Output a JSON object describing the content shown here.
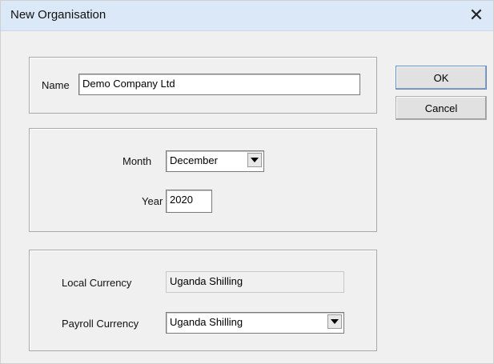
{
  "window": {
    "title": "New Organisation",
    "close_glyph": "✕"
  },
  "name_section": {
    "label": "Name",
    "value": "Demo Company Ltd"
  },
  "period_section": {
    "month_label": "Month",
    "month_value": "December",
    "year_label": "Year",
    "year_value": "2020"
  },
  "currency_section": {
    "local_label": "Local Currency",
    "local_value": "Uganda Shilling",
    "payroll_label": "Payroll Currency",
    "payroll_value": "Uganda Shilling"
  },
  "buttons": {
    "ok": "OK",
    "cancel": "Cancel"
  },
  "icons": {
    "close": "close-icon",
    "dropdown": "chevron-down-icon"
  }
}
